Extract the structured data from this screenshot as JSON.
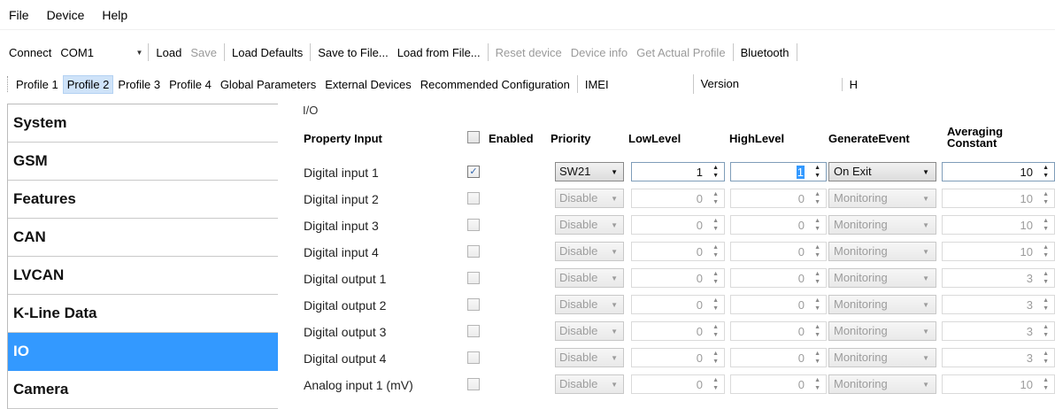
{
  "menu": [
    "File",
    "Device",
    "Help"
  ],
  "toolbar": {
    "connect_label": "Connect",
    "port": "COM1",
    "load": "Load",
    "save": "Save",
    "load_defaults": "Load Defaults",
    "save_to_file": "Save to File...",
    "load_from_file": "Load from File...",
    "reset_device": "Reset device",
    "device_info": "Device info",
    "get_actual_profile": "Get Actual Profile",
    "bluetooth": "Bluetooth"
  },
  "tabs": [
    "Profile 1",
    "Profile 2",
    "Profile 3",
    "Profile 4",
    "Global Parameters",
    "External Devices",
    "Recommended Configuration",
    "IMEI"
  ],
  "active_tab": "Profile 2",
  "version_label": "Version",
  "cut_label": "H",
  "sidebar": {
    "items": [
      "System",
      "GSM",
      "Features",
      "CAN",
      "LVCAN",
      "K-Line Data",
      "IO",
      "Camera"
    ],
    "selected": "IO"
  },
  "io": {
    "group_title": "I/O",
    "columns": {
      "property_input": "Property Input",
      "enabled": "Enabled",
      "priority": "Priority",
      "low_level": "LowLevel",
      "high_level": "HighLevel",
      "generate_event": "GenerateEvent",
      "averaging_1": "Averaging",
      "averaging_2": "Constant"
    },
    "rows": [
      {
        "name": "Digital input 1",
        "enabled": true,
        "check": "✓",
        "priority": "SW21",
        "low": "1",
        "high": "1",
        "event": "On Exit",
        "avg": "10"
      },
      {
        "name": "Digital input 2",
        "enabled": false,
        "check": "",
        "priority": "Disable",
        "low": "0",
        "high": "0",
        "event": "Monitoring",
        "avg": "10"
      },
      {
        "name": "Digital input 3",
        "enabled": false,
        "check": "",
        "priority": "Disable",
        "low": "0",
        "high": "0",
        "event": "Monitoring",
        "avg": "10"
      },
      {
        "name": "Digital input 4",
        "enabled": false,
        "check": "",
        "priority": "Disable",
        "low": "0",
        "high": "0",
        "event": "Monitoring",
        "avg": "10"
      },
      {
        "name": "Digital output 1",
        "enabled": false,
        "check": "",
        "priority": "Disable",
        "low": "0",
        "high": "0",
        "event": "Monitoring",
        "avg": "3"
      },
      {
        "name": "Digital output 2",
        "enabled": false,
        "check": "",
        "priority": "Disable",
        "low": "0",
        "high": "0",
        "event": "Monitoring",
        "avg": "3"
      },
      {
        "name": "Digital output 3",
        "enabled": false,
        "check": "",
        "priority": "Disable",
        "low": "0",
        "high": "0",
        "event": "Monitoring",
        "avg": "3"
      },
      {
        "name": "Digital output 4",
        "enabled": false,
        "check": "",
        "priority": "Disable",
        "low": "0",
        "high": "0",
        "event": "Monitoring",
        "avg": "3"
      },
      {
        "name": "Analog input 1 (mV)",
        "enabled": false,
        "check": "",
        "priority": "Disable",
        "low": "0",
        "high": "0",
        "event": "Monitoring",
        "avg": "10"
      }
    ]
  },
  "colors": {
    "selection": "#3399ff",
    "tab_active": "#cfe3f9",
    "disabled_text": "#9c9c9c"
  }
}
